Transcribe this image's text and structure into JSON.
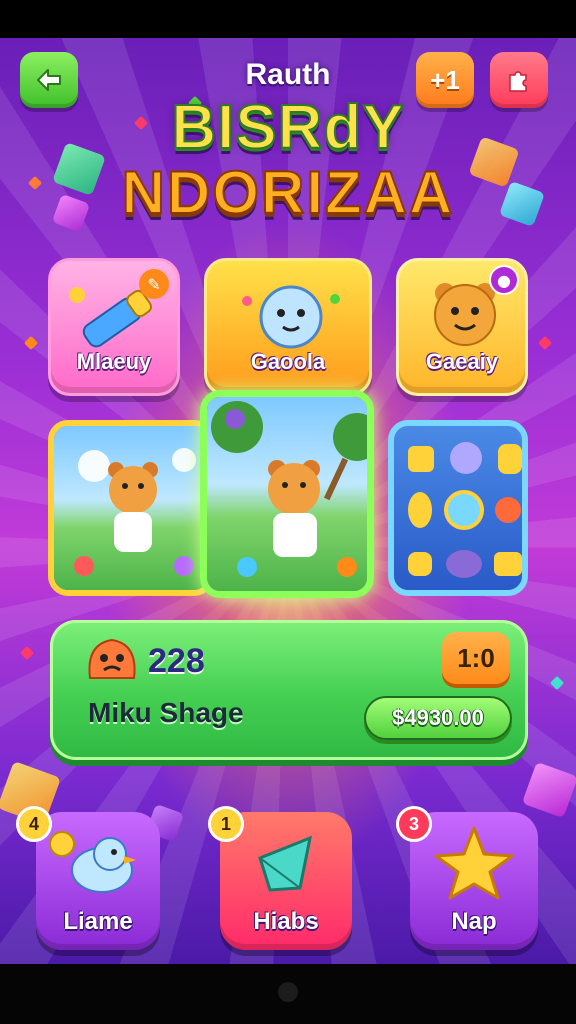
{
  "header": {
    "back_icon": "arrow-left-icon",
    "counter_label": "+1",
    "puzzle_icon": "puzzle-piece-icon",
    "subtitle": "Rauth",
    "title_line1": "BISRdY",
    "title_line2": "NDORIZAA"
  },
  "categories": [
    {
      "label": "Mlaeuy",
      "icon": "crayon-icon"
    },
    {
      "label": "Gaoola",
      "icon": "blob-monster-icon"
    },
    {
      "label": "Gaeaiy",
      "icon": "bear-icon"
    }
  ],
  "scenes": [
    {
      "name": "bear-meadow-scene"
    },
    {
      "name": "bear-painting-scene"
    },
    {
      "name": "gem-collection-scene"
    }
  ],
  "stats": {
    "score": "228",
    "level": "1:0",
    "player_name": "Miku Shage",
    "price": "$4930.00"
  },
  "nav": [
    {
      "label": "Liame",
      "badge": "4",
      "icon": "bird-icon"
    },
    {
      "label": "Hiabs",
      "badge": "1",
      "icon": "crystal-icon"
    },
    {
      "label": "Nap",
      "badge": "3",
      "icon": "star-icon"
    }
  ],
  "colors": {
    "back_button": "#4fd63a",
    "counter_button": "#ff8a1a",
    "puzzle_button": "#ff4a6a",
    "panel_green": "#44cf52",
    "nav_purple": "#a23ae0",
    "nav_red": "#ff3a6a"
  }
}
